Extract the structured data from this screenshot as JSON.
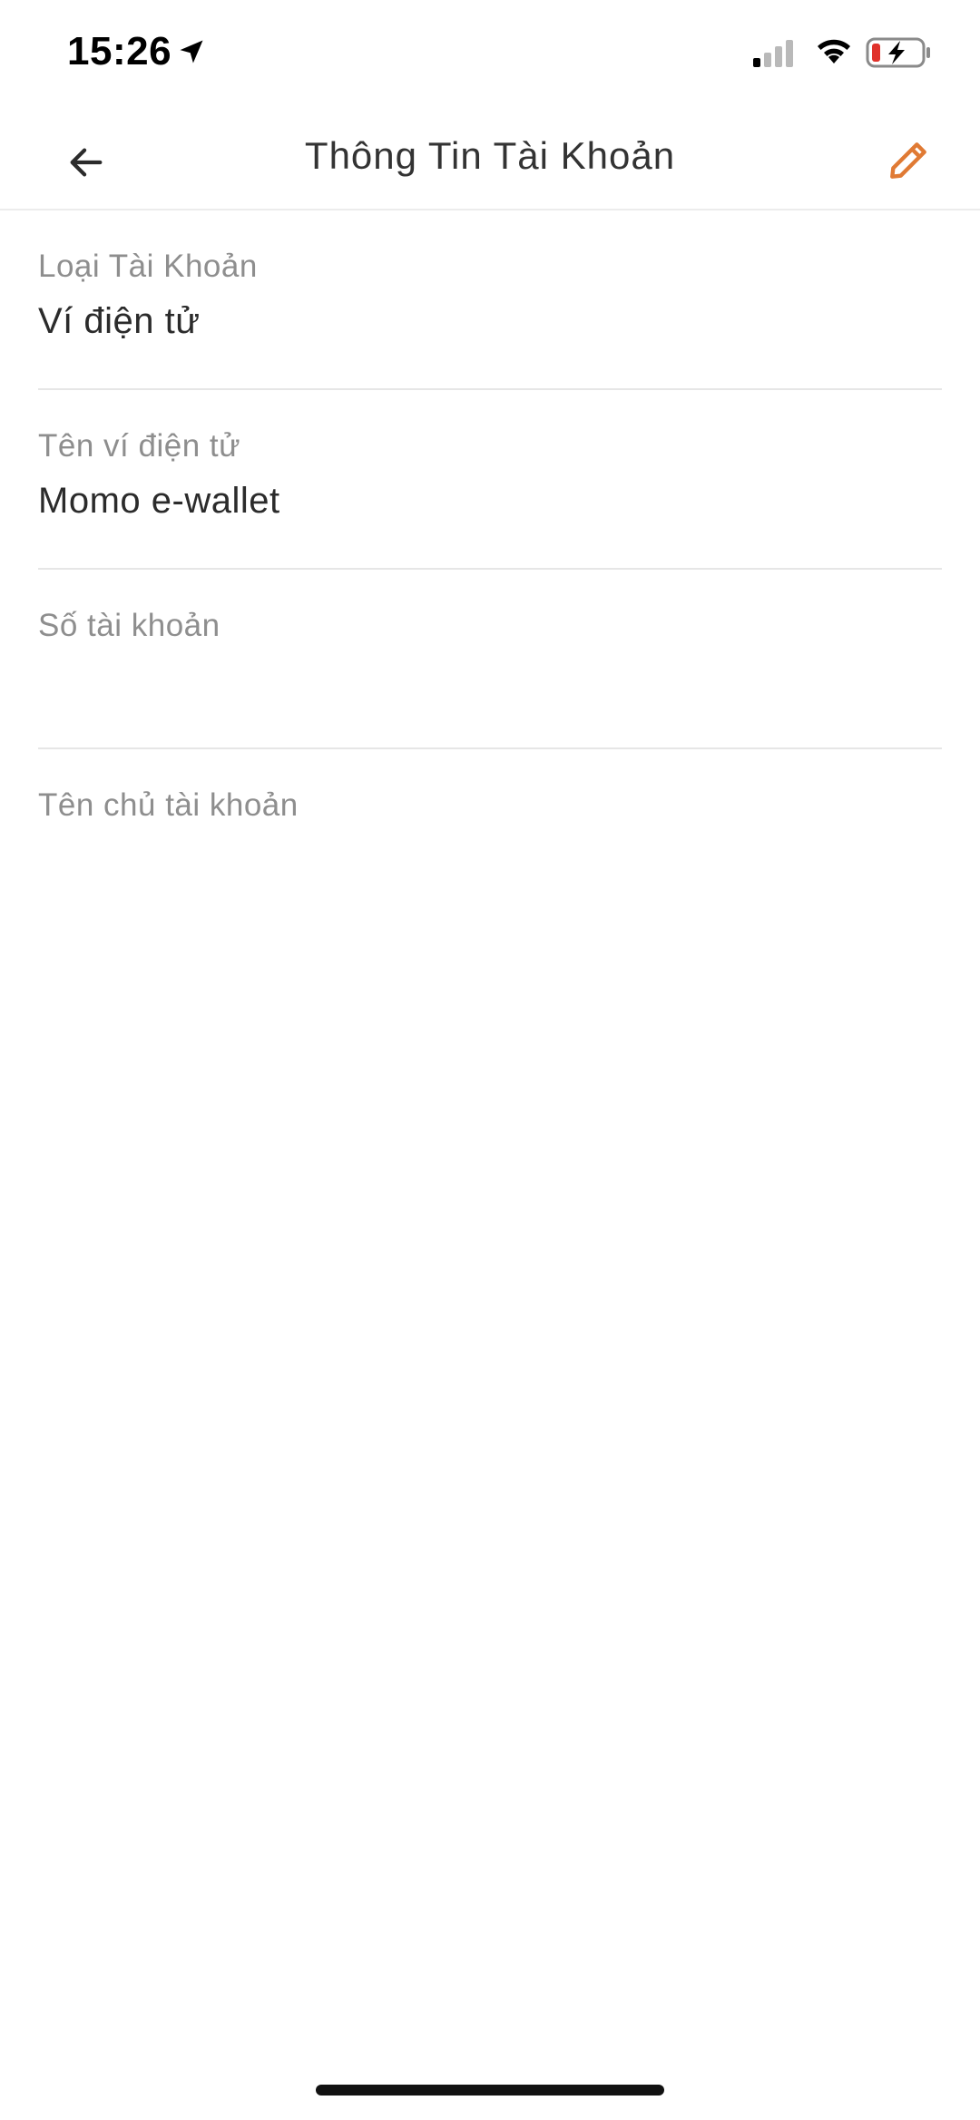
{
  "status_bar": {
    "time": "15:26"
  },
  "header": {
    "title": "Thông Tin Tài Khoản",
    "accent_color": "#e07a34"
  },
  "fields": [
    {
      "label": "Loại Tài Khoản",
      "value": "Ví điện tử"
    },
    {
      "label": "Tên ví điện tử",
      "value": "Momo e-wallet"
    },
    {
      "label": "Số tài khoản",
      "value": ""
    },
    {
      "label": "Tên chủ tài khoản",
      "value": ""
    }
  ],
  "icons": {
    "back": "arrow-left-icon",
    "edit": "pencil-icon",
    "location": "location-arrow-icon",
    "signal": "cellular-signal-icon",
    "wifi": "wifi-icon",
    "battery": "battery-charging-icon"
  }
}
